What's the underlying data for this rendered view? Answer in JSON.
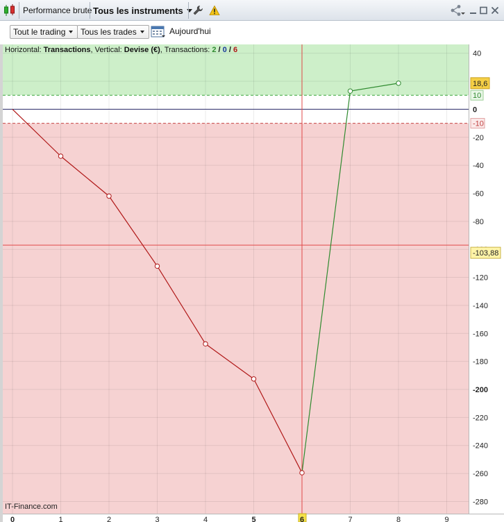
{
  "window": {
    "chart_type_label": "Performance brute",
    "instruments_label": "Tous les instruments"
  },
  "toolbar": {
    "trading_filter": "Tout le trading",
    "trades_filter": "Tous les trades",
    "date_label": "Aujourd'hui"
  },
  "info": {
    "prefix": "Horizontal: ",
    "horizontal": "Transactions",
    "vertical_prefix": ", Vertical: ",
    "vertical": "Devise (€)",
    "transactions_prefix": ", Transactions: ",
    "count_win": "2",
    "sep1": " / ",
    "count_neutral": "0",
    "sep2": " / ",
    "count_loss": "6"
  },
  "watermark": "IT-Finance.com",
  "colors": {
    "positive_zone": "#cdefc9",
    "negative_zone": "#f6d2d2",
    "gain_line": "#2f8a2f",
    "loss_line": "#b01818",
    "crosshair": "#e04848",
    "highlight_label": "#fff4a8"
  },
  "chart_data": {
    "type": "line",
    "x": [
      0,
      1,
      2,
      3,
      4,
      5,
      6,
      7,
      8
    ],
    "y": [
      0,
      -33.5,
      -62,
      -112,
      -167.5,
      -192.5,
      -259.5,
      13,
      18.6
    ],
    "point_colors": [
      "red",
      "red",
      "red",
      "red",
      "red",
      "red",
      "red",
      "green",
      "green"
    ],
    "xlim": [
      0,
      9.4
    ],
    "ylim": [
      -280,
      40
    ],
    "x_ticks": [
      "0",
      "1",
      "2",
      "3",
      "4",
      "5",
      "6",
      "7",
      "8",
      "9"
    ],
    "y_ticks": [
      "40",
      "20",
      "0",
      "-20",
      "-40",
      "-60",
      "-80",
      "-100",
      "-120",
      "-140",
      "-160",
      "-180",
      "-200",
      "-220",
      "-240",
      "-260",
      "-280"
    ],
    "y_tick_values": [
      40,
      20,
      0,
      -20,
      -40,
      -60,
      -80,
      -100,
      -120,
      -140,
      -160,
      -180,
      -200,
      -220,
      -240,
      -260,
      -280
    ],
    "upper_threshold": 10,
    "upper_threshold_label": "10",
    "lower_threshold": -10,
    "lower_threshold_label": "-10",
    "last_value": 18.6,
    "last_value_label": "18,6",
    "cursor_value": -97,
    "cursor_value_label": "-103,88",
    "cursor_x": 6,
    "cursor_x_label": "6",
    "grid": true
  }
}
